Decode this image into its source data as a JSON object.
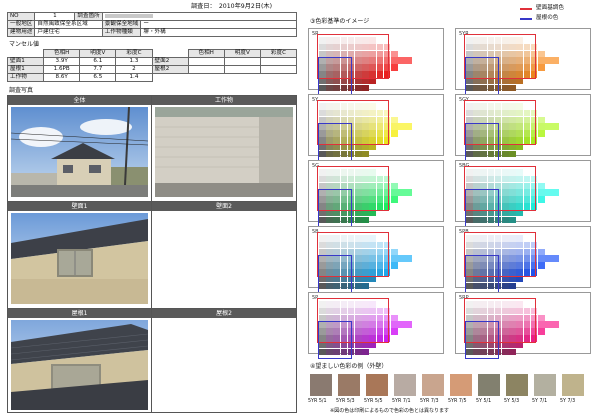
{
  "survey_date": "調査日：　2010年9月2日(木)",
  "header": {
    "no_label": "NO",
    "no_value": "1",
    "location_label": "調査箇所",
    "zone_label": "一般地区",
    "zone_value": "自然風致保全系区域",
    "scenic_label": "景観保全地域",
    "scenic_value": "ー",
    "use_label": "建物用途",
    "use_value": "戸建住宅",
    "structure_label": "工作物種類",
    "structure_value": "塀・外構"
  },
  "munsell": {
    "title": "マンセル値",
    "headers": [
      "色相H",
      "明度V",
      "彩度C"
    ],
    "rows": [
      {
        "name": "壁面1",
        "h": "3.9Y",
        "v": "6.1",
        "c": "1.3"
      },
      {
        "name": "屋根1",
        "h": "1.6PB",
        "v": "7.7",
        "c": "2"
      },
      {
        "name": "工作物",
        "h": "8.6Y",
        "v": "6.5",
        "c": "1.4"
      }
    ],
    "right_rows": [
      "壁面2",
      "屋根2"
    ]
  },
  "photos": {
    "title": "調査写真",
    "labels": [
      "全体",
      "工作物",
      "壁面1",
      "壁面2",
      "屋根1",
      "屋根2"
    ]
  },
  "color_image": {
    "title": "③色彩基準のイメージ",
    "legend": [
      {
        "label": "壁面基調色",
        "color": "#e0303a"
      },
      {
        "label": "屋根の色",
        "color": "#3838c8"
      }
    ],
    "charts": [
      {
        "label": "5R",
        "hue": 0
      },
      {
        "label": "5YR",
        "hue": 30
      },
      {
        "label": "5Y",
        "hue": 58
      },
      {
        "label": "5GY",
        "hue": 80
      },
      {
        "label": "5G",
        "hue": 140
      },
      {
        "label": "5BG",
        "hue": 175
      },
      {
        "label": "5B",
        "hue": 200
      },
      {
        "label": "5PB",
        "hue": 225
      },
      {
        "label": "5P",
        "hue": 290
      },
      {
        "label": "5RP",
        "hue": 330
      }
    ]
  },
  "examples": {
    "title": "④望ましい色彩の例（外壁）",
    "swatches": [
      {
        "label": "5YR 5/1",
        "color": "#8a7a70"
      },
      {
        "label": "5YR 5/3",
        "color": "#9a7a66"
      },
      {
        "label": "5YR 5/5",
        "color": "#a97758"
      },
      {
        "label": "5YR 7/1",
        "color": "#b8aba3"
      },
      {
        "label": "5YR 7/3",
        "color": "#c9a58e"
      },
      {
        "label": "5YR 7/5",
        "color": "#d59b76"
      },
      {
        "label": "5Y 5/1",
        "color": "#82806f"
      },
      {
        "label": "5Y 5/3",
        "color": "#8c8462"
      },
      {
        "label": "5Y 7/1",
        "color": "#b3b0a0"
      },
      {
        "label": "5Y 7/3",
        "color": "#bfb38c"
      }
    ],
    "note": "※図の色は印刷によるもので色彩の色とは異なります"
  }
}
